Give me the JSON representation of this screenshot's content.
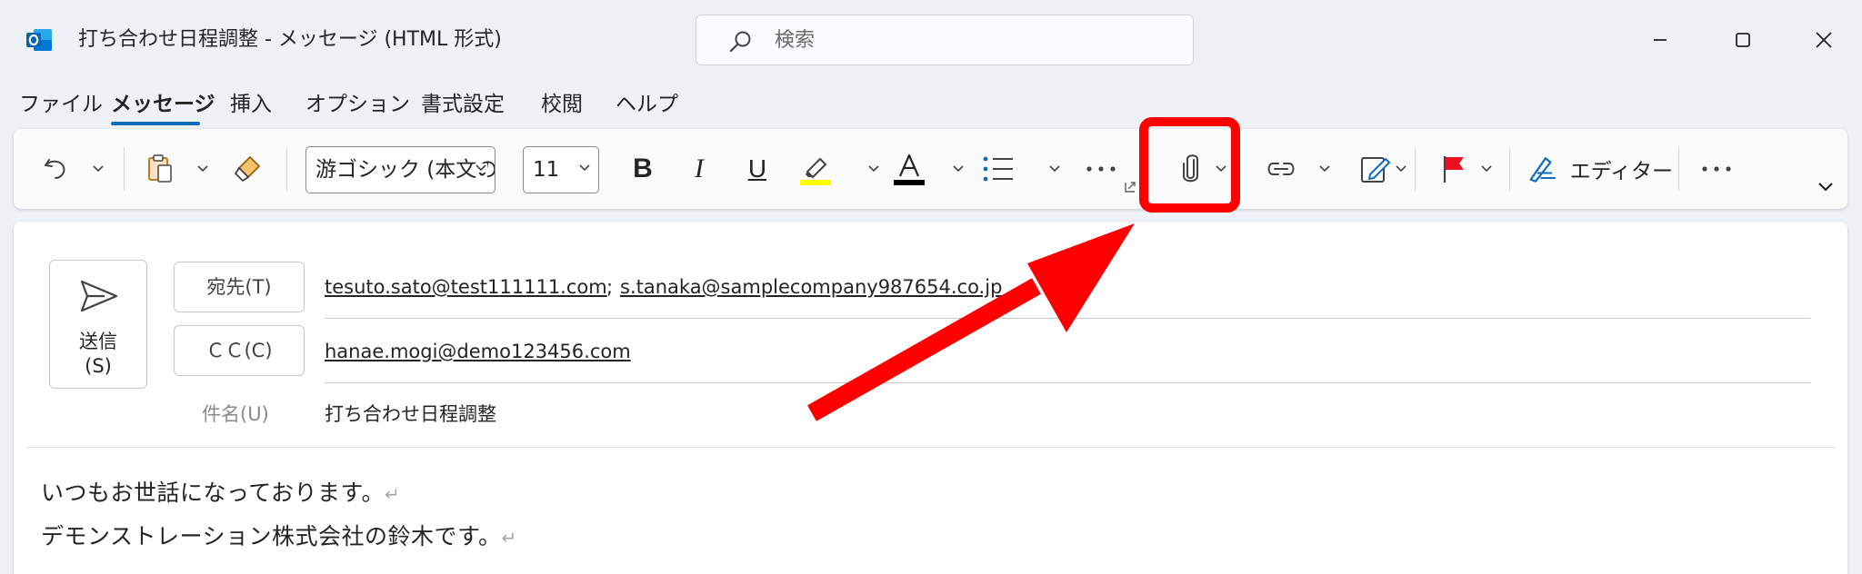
{
  "window": {
    "title": "打ち合わせ日程調整  -  メッセージ (HTML 形式)",
    "app_icon": "outlook-icon",
    "search_placeholder": "検索",
    "controls": [
      "minimize-icon",
      "maximize-icon",
      "close-icon"
    ]
  },
  "tabs": [
    {
      "label": "ファイル"
    },
    {
      "label": "メッセージ",
      "selected": true
    },
    {
      "label": "挿入"
    },
    {
      "label": "オプション"
    },
    {
      "label": "書式設定"
    },
    {
      "label": "校閲"
    },
    {
      "label": "ヘルプ"
    }
  ],
  "ribbon": {
    "font_name": "游ゴシック (本文のフォント)",
    "font_size": "11",
    "bold_label": "B",
    "italic_label": "I",
    "underline_label": "U",
    "editor_label": "エディター",
    "icons": [
      "undo-icon",
      "paste-icon",
      "format-painter-icon",
      "highlight-icon",
      "font-color-icon",
      "bullets-icon",
      "more-icon",
      "attach-file-icon",
      "link-icon",
      "signature-icon",
      "flag-icon",
      "editor-icon",
      "more-icon",
      "collapse-ribbon-icon"
    ],
    "highlight_color": "#ffff00",
    "font_color": "#000000"
  },
  "compose": {
    "send_label": "送信\n(S)",
    "to_label": "宛先(T)",
    "cc_label": "ＣＣ(C)",
    "subject_label": "件名(U)",
    "to_recipients": [
      "tesuto.sato@test111111.com",
      "s.tanaka@samplecompany987654.co.jp"
    ],
    "to_separator": ";",
    "cc_recipients": [
      "hanae.mogi@demo123456.com"
    ],
    "subject": "打ち合わせ日程調整",
    "body_lines": [
      "いつもお世話になっております。",
      "デモンストレーション株式会社の鈴木です。",
      ""
    ],
    "paragraph_mark": "↵"
  },
  "annotation": {
    "color": "#ff0000",
    "target": "attach-file-button"
  },
  "colors": {
    "accent": "#0f6cbd",
    "window_bg": "#eef1f6",
    "outlook_blue": "#0364b8"
  }
}
